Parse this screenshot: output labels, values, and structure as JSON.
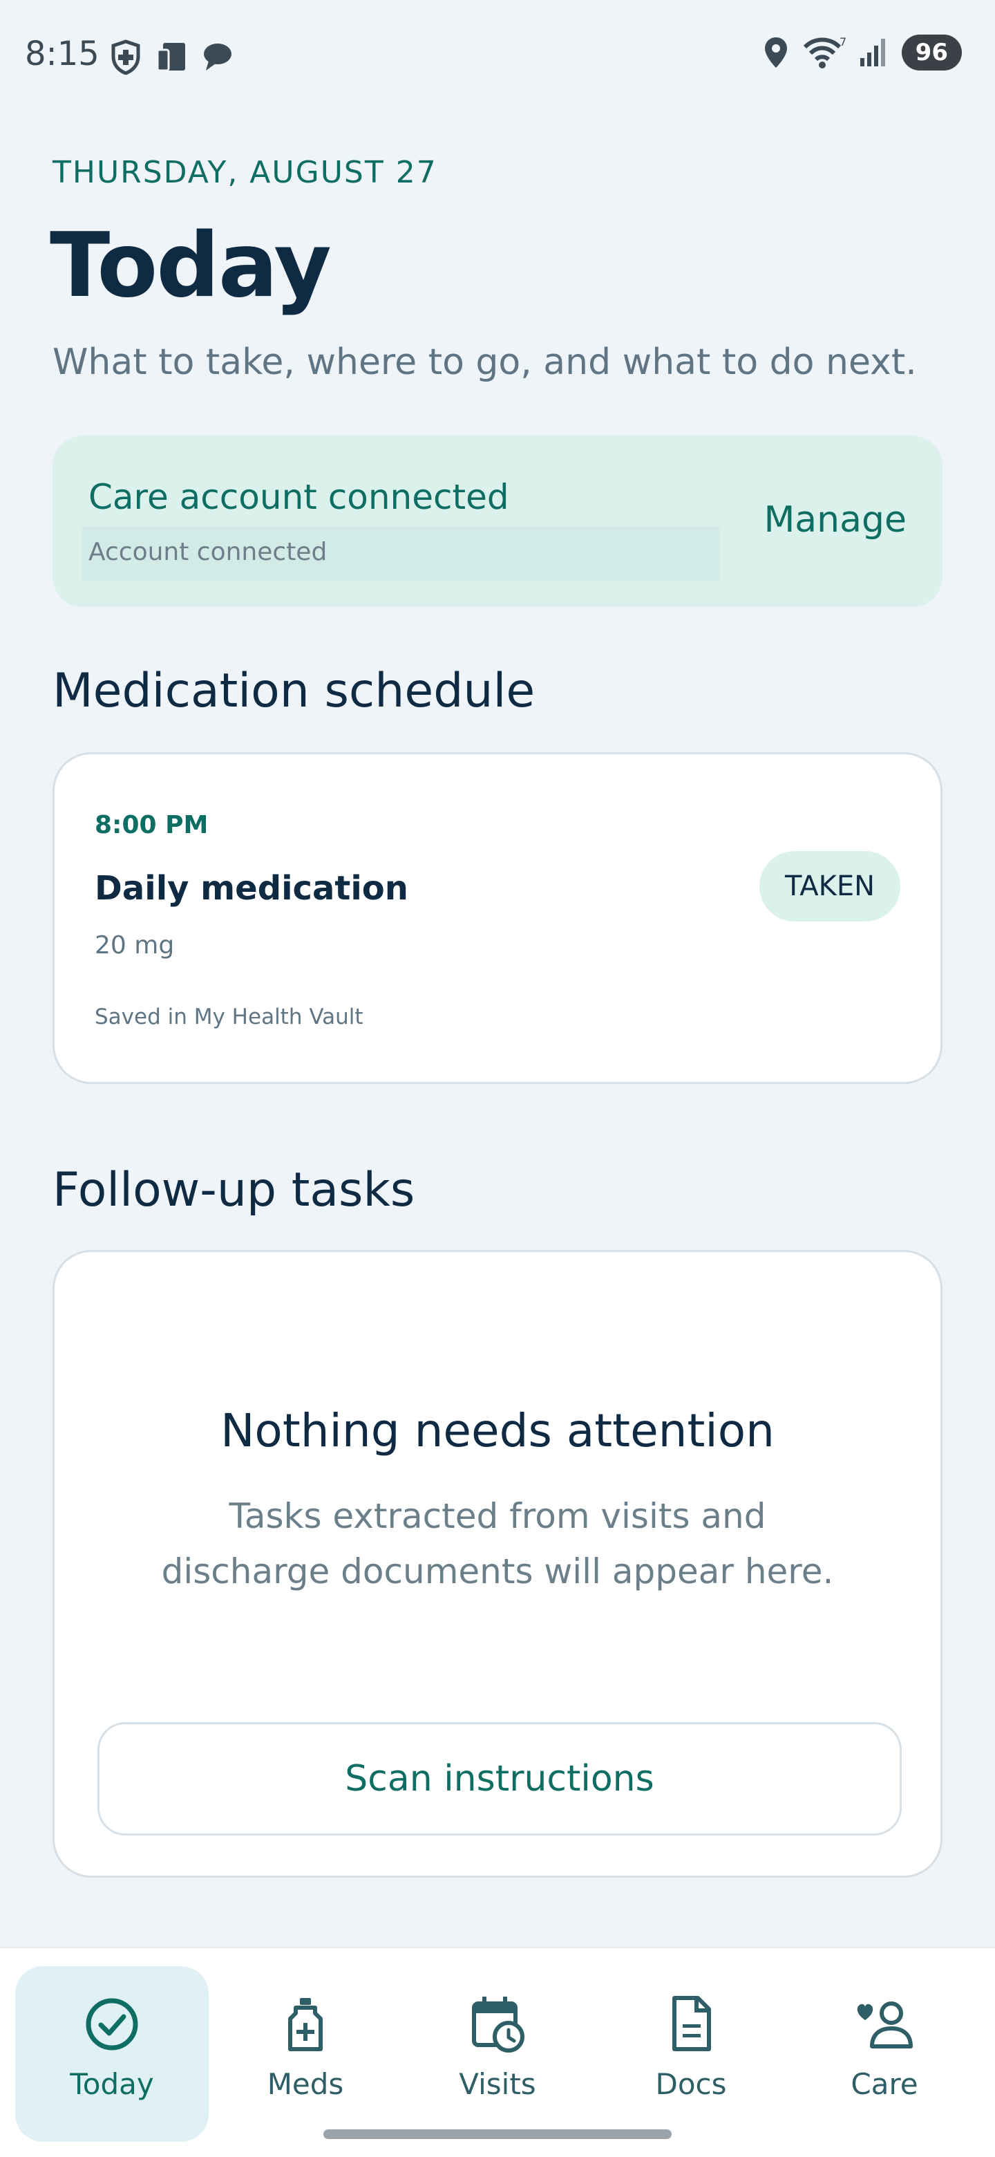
{
  "status_bar": {
    "time": "8:15",
    "battery": "96",
    "left_icons": [
      "medical-app-icon",
      "device-icon",
      "chat-bubble-icon"
    ],
    "right_icons": [
      "location-icon",
      "wifi-icon",
      "signal-icon"
    ],
    "wifi_badge": "7"
  },
  "header": {
    "date": "THURSDAY, AUGUST 27",
    "title": "Today",
    "subtitle": "What to take, where to go, and what to do next."
  },
  "account": {
    "title": "Care account connected",
    "status": "Account connected",
    "manage_label": "Manage"
  },
  "medication": {
    "heading": "Medication schedule",
    "time": "8:00 PM",
    "name": "Daily medication",
    "dose": "20 mg",
    "source": "Saved in My Health Vault",
    "status_badge": "TAKEN"
  },
  "tasks": {
    "heading": "Follow-up tasks",
    "empty_title": "Nothing needs attention",
    "empty_body_line1": "Tasks extracted from visits and",
    "empty_body_line2": "discharge documents will appear here.",
    "scan_label": "Scan instructions"
  },
  "nav": {
    "items": [
      {
        "label": "Today",
        "icon": "check-circle-icon",
        "active": true
      },
      {
        "label": "Meds",
        "icon": "medicine-bottle-icon",
        "active": false
      },
      {
        "label": "Visits",
        "icon": "calendar-clock-icon",
        "active": false
      },
      {
        "label": "Docs",
        "icon": "document-icon",
        "active": false
      },
      {
        "label": "Care",
        "icon": "care-person-icon",
        "active": false
      }
    ]
  },
  "colors": {
    "accent": "#0f6e63",
    "text_primary": "#0f2a43",
    "background": "#eff4f8",
    "account_card": "#dbf1ec"
  }
}
